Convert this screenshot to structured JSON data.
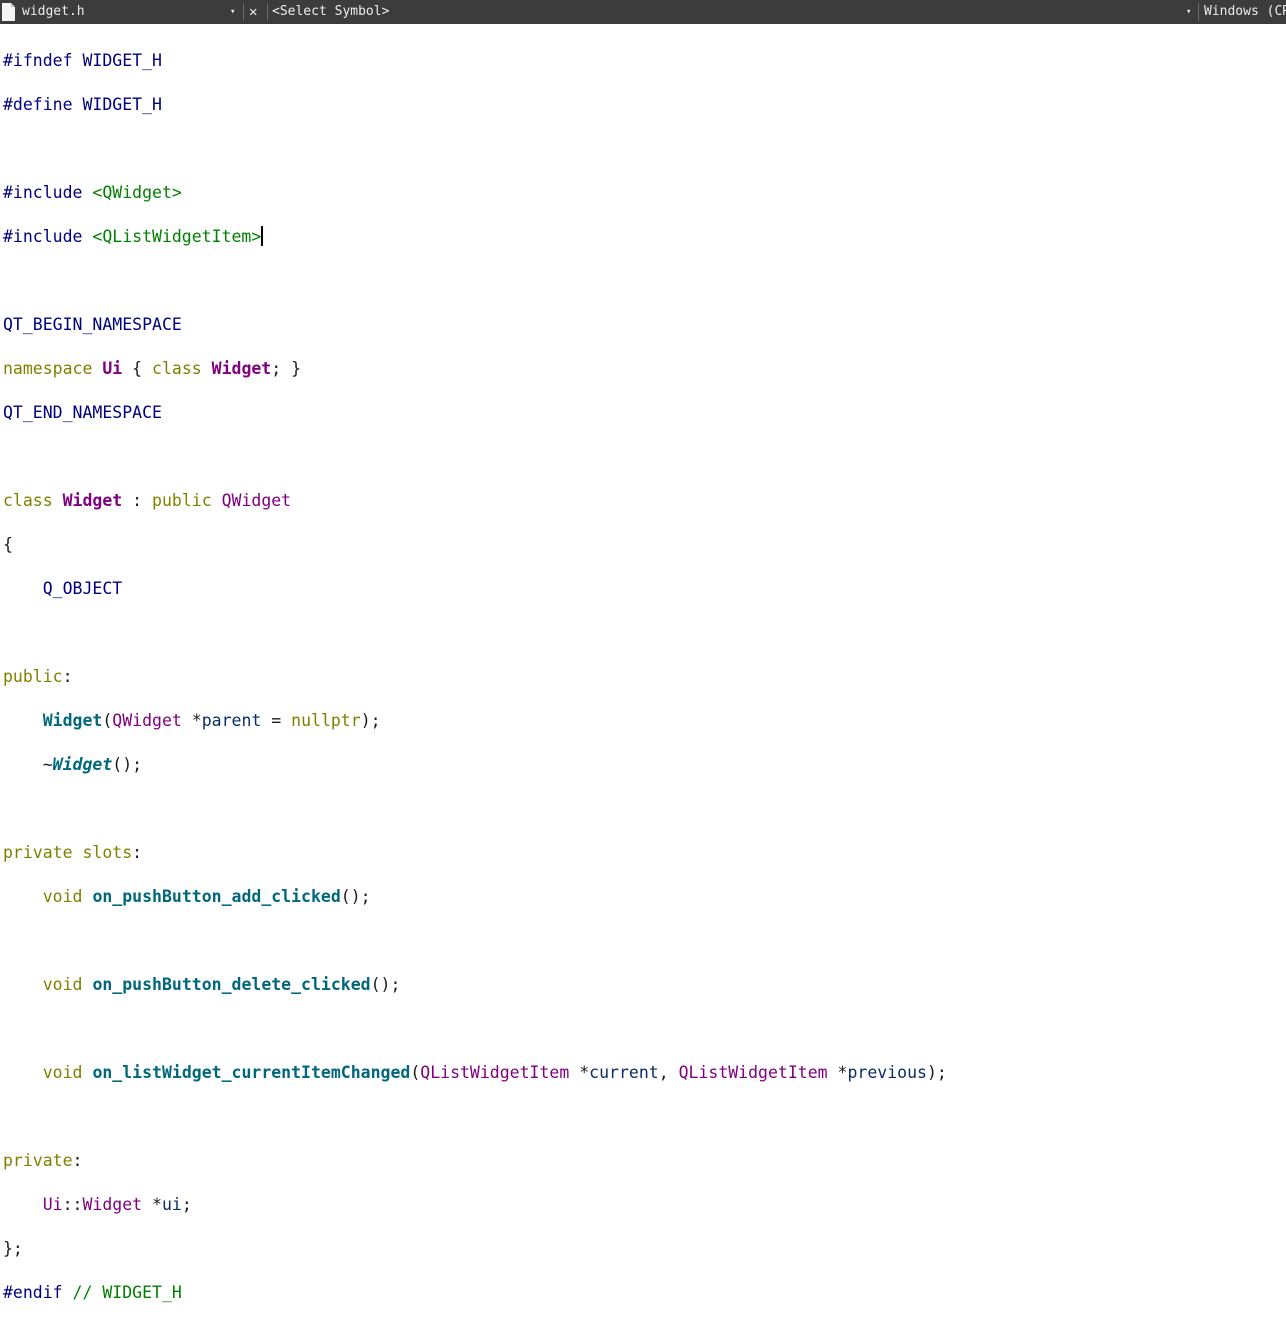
{
  "toolbar": {
    "file_name": "widget.h",
    "file_dropdown": "▾",
    "close": "✕",
    "symbol": "<Select Symbol>",
    "symbol_dropdown": "▾",
    "line_ending": "Windows (CRLF)"
  },
  "icons": {
    "file": "file-icon",
    "file_dropdown": "chevron-down-icon",
    "close": "close-icon",
    "symbol_dropdown": "chevron-down-icon"
  },
  "colors": {
    "toolbar_bg": "#3c3c3c",
    "editor_bg": "#ffffff",
    "preprocessor": "#000080",
    "string": "#008000",
    "keyword": "#808000",
    "type": "#800080",
    "function": "#00677c"
  },
  "code": {
    "l1": {
      "a": "#ifndef WIDGET_H"
    },
    "l2": {
      "a": "#define WIDGET_H"
    },
    "l4": {
      "a": "#include ",
      "b": "<QWidget>"
    },
    "l5": {
      "a": "#include ",
      "b": "<QListWidgetItem>"
    },
    "l7": {
      "a": "QT_BEGIN_NAMESPACE"
    },
    "l8": {
      "a": "namespace",
      "b": " ",
      "c": "Ui",
      "d": " { ",
      "e": "class",
      "f": " ",
      "g": "Widget",
      "h": "; }"
    },
    "l9": {
      "a": "QT_END_NAMESPACE"
    },
    "l11": {
      "a": "class",
      "b": " ",
      "c": "Widget",
      "d": " : ",
      "e": "public",
      "f": " ",
      "g": "QWidget"
    },
    "l12": {
      "a": "{"
    },
    "l13": {
      "a": "    ",
      "b": "Q_OBJECT"
    },
    "l15": {
      "a": "public",
      "b": ":"
    },
    "l16": {
      "a": "    ",
      "b": "Widget",
      "c": "(",
      "d": "QWidget",
      "e": " *",
      "f": "parent",
      "g": " = ",
      "h": "nullptr",
      "i": ");"
    },
    "l17": {
      "a": "    ~",
      "b": "Widget",
      "c": "();"
    },
    "l19": {
      "a": "private",
      "b": " ",
      "c": "slots",
      "d": ":"
    },
    "l20": {
      "a": "    ",
      "b": "void",
      "c": " ",
      "d": "on_pushButton_add_clicked",
      "e": "();"
    },
    "l22": {
      "a": "    ",
      "b": "void",
      "c": " ",
      "d": "on_pushButton_delete_clicked",
      "e": "();"
    },
    "l24": {
      "a": "    ",
      "b": "void",
      "c": " ",
      "d": "on_listWidget_currentItemChanged",
      "e": "(",
      "f": "QListWidgetItem",
      "g": " *",
      "h": "current",
      "i": ", ",
      "j": "QListWidgetItem",
      "k": " *",
      "l": "previous",
      "m": ");"
    },
    "l26": {
      "a": "private",
      "b": ":"
    },
    "l27": {
      "a": "    ",
      "b": "Ui",
      "c": "::",
      "d": "Widget",
      "e": " *",
      "f": "ui",
      "g": ";"
    },
    "l28": {
      "a": "};"
    },
    "l29": {
      "a": "#endif",
      "b": " ",
      "c": "// WIDGET_H"
    }
  }
}
